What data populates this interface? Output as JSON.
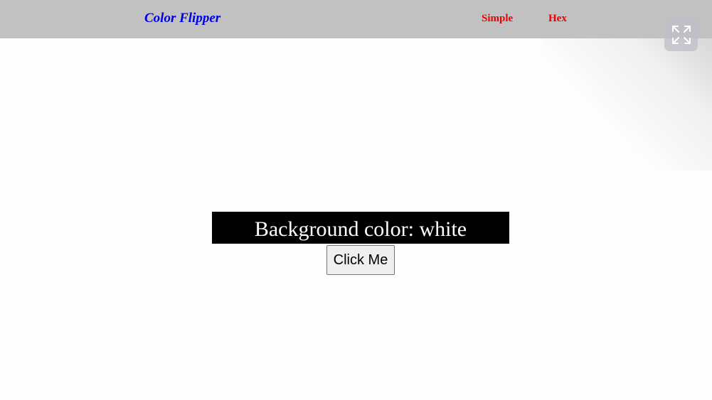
{
  "navbar": {
    "brand": "Color Flipper",
    "links": [
      {
        "label": "Simple"
      },
      {
        "label": "Hex"
      }
    ]
  },
  "main": {
    "label_prefix": "Background color: ",
    "current_color": "white",
    "button_label": "Click Me"
  },
  "colors": {
    "navbar_bg": "#c1c1c1",
    "brand": "#0000e6",
    "nav_link": "#ee0000",
    "page_bg": "#fefefe",
    "label_bg": "#000000",
    "label_text": "#ffffff"
  },
  "icons": {
    "fullscreen": "expand-arrows-icon"
  }
}
